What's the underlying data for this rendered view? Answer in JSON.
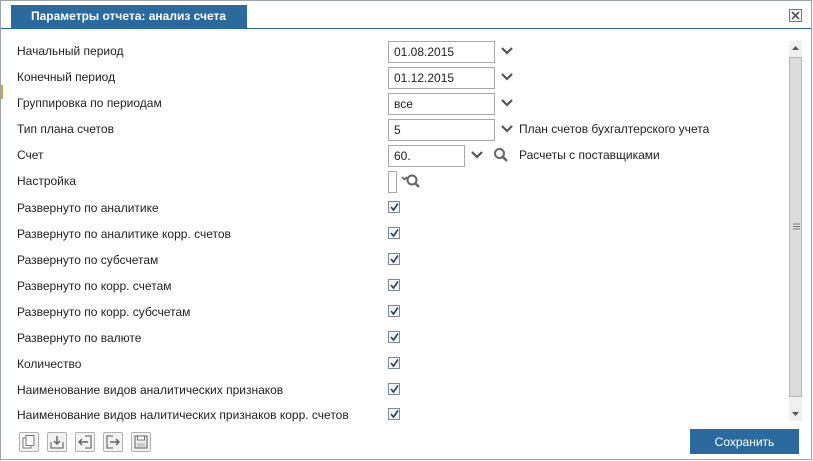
{
  "dialog": {
    "title": "Параметры отчета: анализ счета"
  },
  "fields": {
    "start_period": {
      "label": "Начальный период",
      "value": "01.08.2015"
    },
    "end_period": {
      "label": "Конечный период",
      "value": "01.12.2015"
    },
    "grouping": {
      "label": "Группировка по периодам",
      "value": "все"
    },
    "chart_type": {
      "label": "Тип плана счетов",
      "value": "5",
      "description": "План счетов бухгалтерского учета"
    },
    "account": {
      "label": "Счет",
      "value": "60.",
      "description": "Расчеты с поставщиками"
    },
    "setting": {
      "label": "Настройка",
      "value": ""
    }
  },
  "checkboxes": [
    {
      "label": "Развернуто по аналитике",
      "checked": true
    },
    {
      "label": "Развернуто по аналитике корр. счетов",
      "checked": true
    },
    {
      "label": "Развернуто по субсчетам",
      "checked": true
    },
    {
      "label": "Развернуто по корр. счетам",
      "checked": true
    },
    {
      "label": "Развернуто по корр. субсчетам",
      "checked": true
    },
    {
      "label": "Развернуто по валюте",
      "checked": true
    },
    {
      "label": "Количество",
      "checked": true
    },
    {
      "label": "Наименование видов аналитических признаков",
      "checked": true
    },
    {
      "label": "Наименование видов налитических признаков корр. счетов",
      "checked": true
    }
  ],
  "footer": {
    "save_label": "Сохранить",
    "icons": [
      "copy-icon",
      "import-icon",
      "back-icon",
      "forward-icon",
      "save-disk-icon"
    ]
  },
  "colors": {
    "accent": "#2a6a9e"
  }
}
